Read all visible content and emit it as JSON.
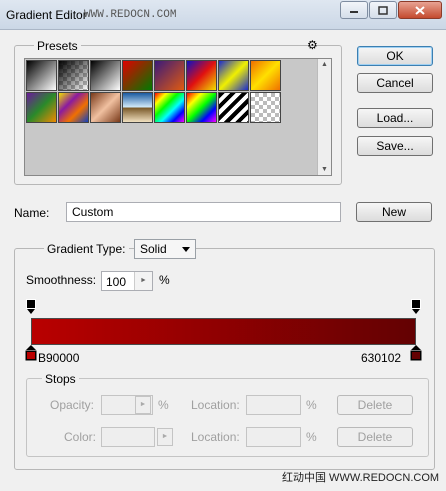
{
  "window": {
    "title": "Gradient Editor",
    "watermark": "WWW.REDOCN.COM"
  },
  "presets": {
    "label": "Presets",
    "gear_icon": "⚙",
    "swatches": [
      {
        "name": "foreground-to-background",
        "css": "linear-gradient(135deg,#000 0%,#fff 100%)"
      },
      {
        "name": "foreground-to-transparent",
        "css": "checker-black"
      },
      {
        "name": "black-white",
        "css": "linear-gradient(135deg,#000 0%,#fff 100%)"
      },
      {
        "name": "red-green",
        "css": "linear-gradient(135deg,#e00000 0%,#007a00 100%)"
      },
      {
        "name": "violet-orange",
        "css": "linear-gradient(135deg,#3a1a7a 0%,#e05a10 100%)"
      },
      {
        "name": "blue-red-yellow",
        "css": "linear-gradient(135deg,#1010c0 0%,#e01010 50%,#f0e000 100%)"
      },
      {
        "name": "blue-yellow-blue",
        "css": "linear-gradient(135deg,#1a2ad0 0%,#f0f000 50%,#1a2ad0 100%)"
      },
      {
        "name": "orange-yellow-orange",
        "css": "linear-gradient(135deg,#f07000 0%,#ffe000 50%,#f07000 100%)"
      },
      {
        "name": "violet-green-orange",
        "css": "linear-gradient(135deg,#6a1a9a 0%,#2a8a2a 50%,#f08a00 100%)"
      },
      {
        "name": "yellow-violet-orange-blue",
        "css": "linear-gradient(135deg,#f0e000 0%,#8a1aa0 35%,#f07000 65%,#1040c0 100%)"
      },
      {
        "name": "copper",
        "css": "linear-gradient(135deg,#7a3a1a 0%,#f0c0a0 50%,#7a3a1a 100%)"
      },
      {
        "name": "chrome",
        "css": "linear-gradient(180deg,#1a5aa0 0%,#cfe8f8 48%,#7a5a2a 52%,#f0e0c0 100%)"
      },
      {
        "name": "spectrum",
        "css": "linear-gradient(135deg,#f00 0%,#ff0 20%,#0f0 40%,#0ff 60%,#00f 80%,#f0f 100%)"
      },
      {
        "name": "transparent-rainbow",
        "css": "linear-gradient(135deg,#f00 0%,#ff0 25%,#0f0 50%,#00f 75%,#f0f 100%)"
      },
      {
        "name": "transparent-stripes",
        "css": "repeating-linear-gradient(135deg,#000 0 4px,#fff 4px 8px)"
      },
      {
        "name": "transparent",
        "css": "checker"
      }
    ]
  },
  "buttons": {
    "ok": "OK",
    "cancel": "Cancel",
    "load": "Load...",
    "save": "Save...",
    "new": "New",
    "delete": "Delete"
  },
  "name": {
    "label": "Name:",
    "value": "Custom"
  },
  "gradient_type": {
    "label": "Gradient Type:",
    "value": "Solid"
  },
  "smoothness": {
    "label": "Smoothness:",
    "value": "100",
    "unit": "%"
  },
  "gradient": {
    "left_color": "#b90000",
    "right_color": "#630102",
    "left_label": "B90000",
    "right_label": "630102"
  },
  "stops": {
    "label": "Stops",
    "opacity_label": "Opacity:",
    "color_label": "Color:",
    "location_label": "Location:",
    "unit": "%"
  },
  "footer_watermark": "红动中国 WWW.REDOCN.COM"
}
